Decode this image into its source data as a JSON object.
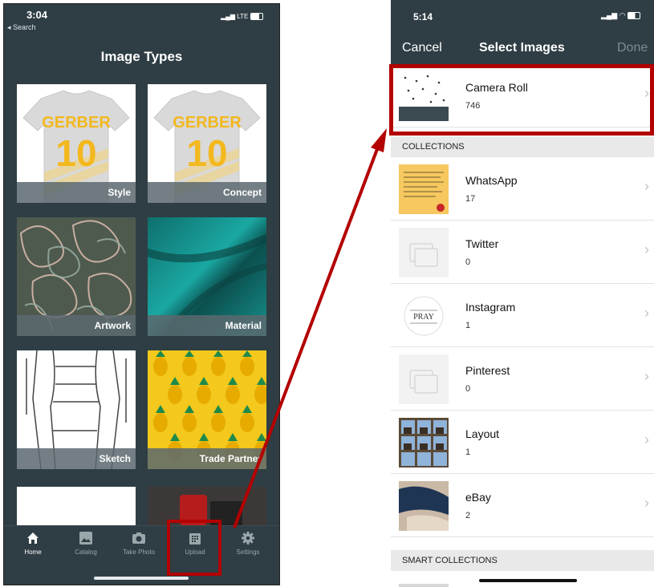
{
  "left_phone": {
    "status_time": "3:04",
    "status_back": "◂ Search",
    "status_signal": "LTE",
    "title": "Image Types",
    "tiles": [
      {
        "label": "Style"
      },
      {
        "label": "Concept"
      },
      {
        "label": "Artwork"
      },
      {
        "label": "Material"
      },
      {
        "label": "Sketch"
      },
      {
        "label": "Trade Partner"
      }
    ],
    "jersey_name": "GERBER",
    "jersey_number": "10",
    "tabs": [
      {
        "label": "Home"
      },
      {
        "label": "Catalog"
      },
      {
        "label": "Take Photo"
      },
      {
        "label": "Upload"
      },
      {
        "label": "Settings"
      }
    ]
  },
  "right_phone": {
    "status_time": "5:14",
    "cancel": "Cancel",
    "title": "Select Images",
    "done": "Done",
    "albums_top": [
      {
        "name": "Camera Roll",
        "count": "746"
      }
    ],
    "sections": [
      "COLLECTIONS",
      "SMART COLLECTIONS"
    ],
    "collections": [
      {
        "name": "WhatsApp",
        "count": "17"
      },
      {
        "name": "Twitter",
        "count": "0"
      },
      {
        "name": "Instagram",
        "count": "1"
      },
      {
        "name": "Pinterest",
        "count": "0"
      },
      {
        "name": "Layout",
        "count": "1"
      },
      {
        "name": "eBay",
        "count": "2"
      }
    ],
    "instagram_thumb_text": "PRAY"
  },
  "colors": {
    "app_dark": "#2e3e44",
    "highlight_red": "#b30000",
    "jersey_yellow": "#f3b81e",
    "teal": "#138f8b"
  }
}
